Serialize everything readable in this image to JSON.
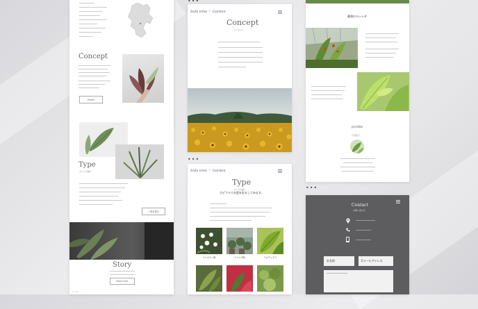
{
  "mockup": {
    "ellipsis": "•••"
  },
  "left_page": {
    "concept_heading": "Concept",
    "concept_button": "Profile",
    "type_heading": "Type",
    "type_sub": "タイプの紹介",
    "type_button": "一覧を見る",
    "story_heading": "Story",
    "story_button": "Read more",
    "footer_text": "Y r t s"
  },
  "middle_top": {
    "logo": "Sofa time ♡ Garden",
    "heading": "Concept",
    "sub": "コンセプト"
  },
  "middle_bottom": {
    "logo": "Sofa time ♡ Garden",
    "heading": "Type",
    "sub": "タイプの紹介",
    "tagline": "カピフルでお庭を彩るしてみます。",
    "thumbs": [
      {
        "label": "ジャスミン科"
      },
      {
        "label": "ユリハギ科"
      },
      {
        "label": "フキテンアイ"
      }
    ]
  },
  "right_top": {
    "section_title": "最適のヨッシタ",
    "profile_title": "profile",
    "profile_sub": "千田和子"
  },
  "right_bottom": {
    "heading": "Contact",
    "sub": "お問い合わせ",
    "name_field": "お名前",
    "email_field": "Eメールアドレス"
  }
}
